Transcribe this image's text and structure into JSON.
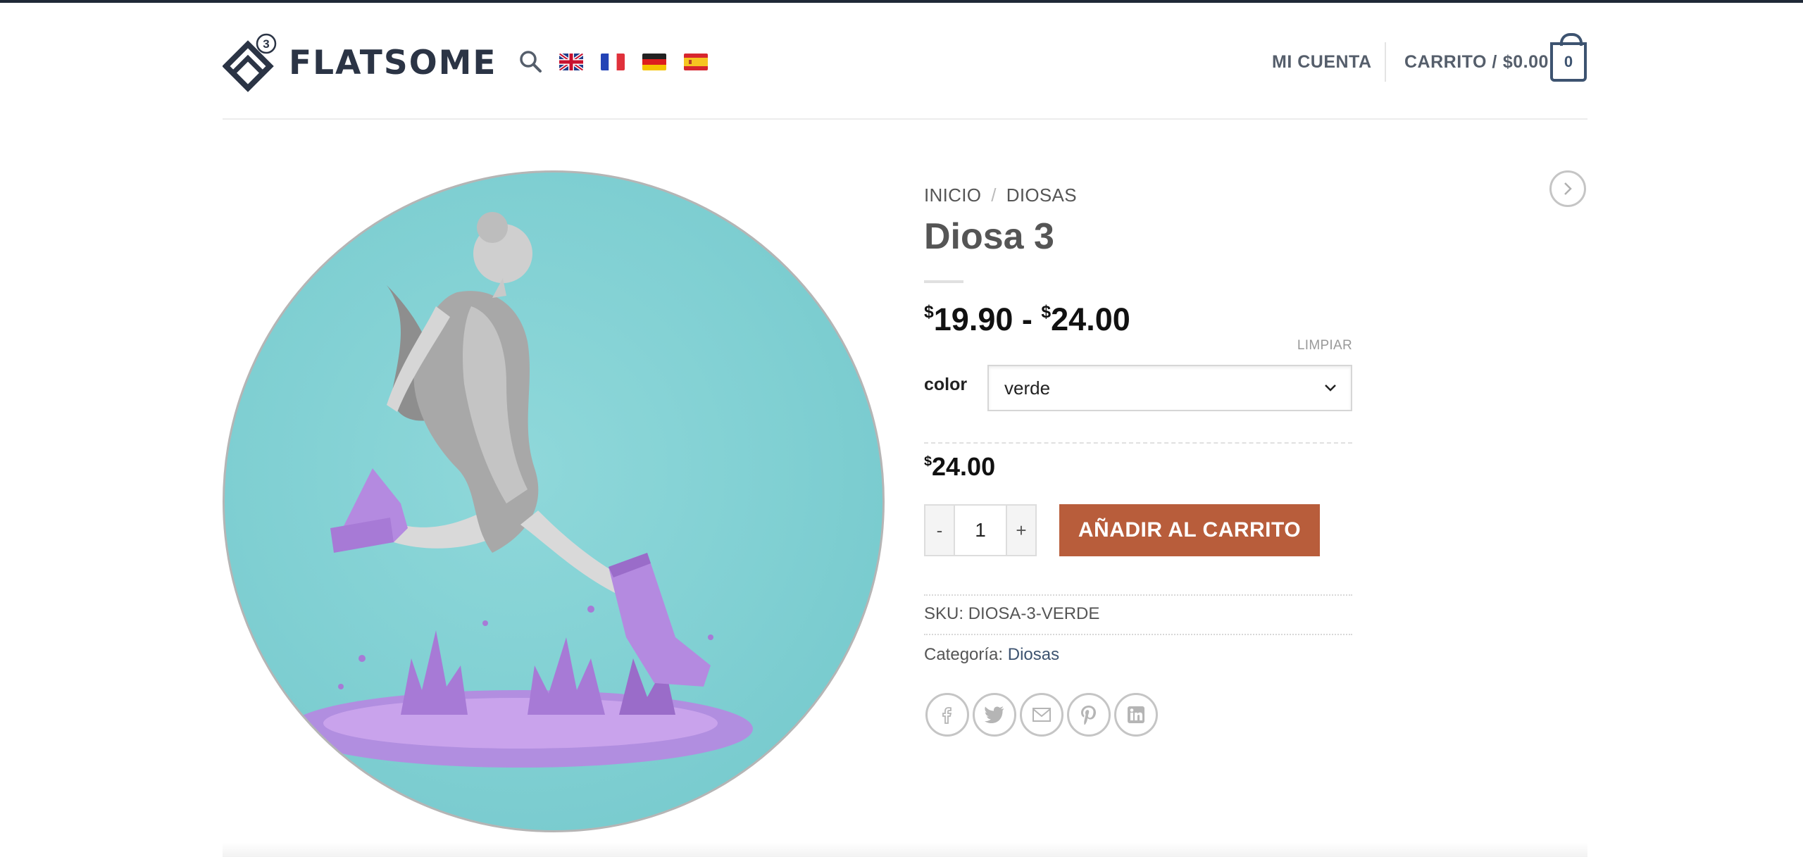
{
  "header": {
    "logo_text": "FLATSOME",
    "logo_badge": "3",
    "languages": [
      "English",
      "Français",
      "Deutsch",
      "Español"
    ],
    "account_label": "MI CUENTA",
    "cart_label": "CARRITO /",
    "cart_total": "$0.00",
    "cart_count": "0"
  },
  "breadcrumb": {
    "home": "INICIO",
    "separator": "/",
    "category": "DIOSAS"
  },
  "product": {
    "title": "Diosa 3",
    "price_from_symbol": "$",
    "price_from": "19.90",
    "price_range_sep": " - ",
    "price_to_symbol": "$",
    "price_to": "24.00",
    "reset_label": "LIMPIAR",
    "attribute_label": "color",
    "attribute_value": "verde",
    "variation_price_symbol": "$",
    "variation_price": "24.00",
    "qty_minus": "-",
    "qty_value": "1",
    "qty_plus": "+",
    "add_to_cart_label": "AÑADIR AL CARRITO",
    "sku_label": "SKU:",
    "sku_value": "DIOSA-3-VERDE",
    "category_label": "Categoría:",
    "category_value": "Diosas"
  },
  "share_icons": [
    "facebook-icon",
    "twitter-icon",
    "email-icon",
    "pinterest-icon",
    "linkedin-icon"
  ],
  "colors": {
    "accent": "#b85d3b",
    "primary": "#3d5370",
    "image_bg": "#7fcfd2",
    "boots": "#b48ae0"
  }
}
